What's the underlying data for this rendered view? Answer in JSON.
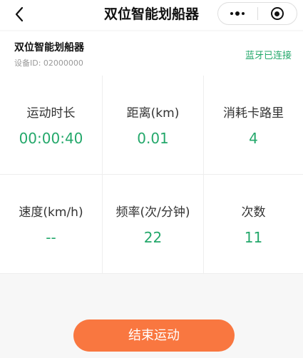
{
  "navbar": {
    "title": "双位智能划船器",
    "back_icon": "chevron-left-icon",
    "menu_icon": "more-dots-icon",
    "close_icon": "target-circle-icon"
  },
  "device": {
    "name": "双位智能划船器",
    "id_label": "设备ID: 02000000",
    "bluetooth_status": "蓝牙已连接"
  },
  "stats": [
    {
      "label": "运动时长",
      "value": "00:00:40"
    },
    {
      "label": "距离(km)",
      "value": "0.01"
    },
    {
      "label": "消耗卡路里",
      "value": "4"
    },
    {
      "label": "速度(km/h)",
      "value": "--"
    },
    {
      "label": "频率(次/分钟)",
      "value": "22"
    },
    {
      "label": "次数",
      "value": "11"
    }
  ],
  "actions": {
    "end_label": "结束运动"
  },
  "colors": {
    "accent_green": "#24a86b",
    "button_orange": "#f97740"
  }
}
